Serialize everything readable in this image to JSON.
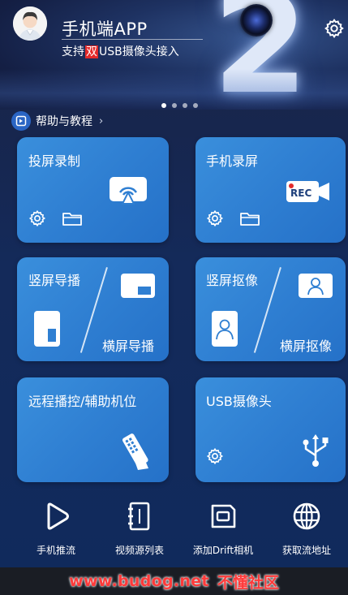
{
  "header": {
    "app_title": "手机端APP",
    "subtitle_before": "支持",
    "subtitle_highlight": "双",
    "subtitle_after": "USB摄像头接入",
    "banner_numeral": "2",
    "carousel_page_count": 4,
    "carousel_active_index": 0
  },
  "help": {
    "label": "帮助与教程",
    "chevron": "›"
  },
  "cards": {
    "screen_cast_record": {
      "label": "投屏录制"
    },
    "phone_record": {
      "label": "手机录屏",
      "rec_badge": "REC"
    },
    "portrait_broadcast": {
      "label": "竖屏导播"
    },
    "landscape_broadcast": {
      "label": "横屏导播"
    },
    "portrait_matting": {
      "label": "竖屏抠像"
    },
    "landscape_matting": {
      "label": "横屏抠像"
    },
    "remote_control": {
      "label": "远程播控/辅助机位"
    },
    "usb_camera": {
      "label": "USB摄像头"
    }
  },
  "bottom_nav": [
    {
      "label": "手机推流",
      "icon": "play-icon"
    },
    {
      "label": "视频源列表",
      "icon": "notebook-icon"
    },
    {
      "label": "添加Drift相机",
      "icon": "sd-card-icon"
    },
    {
      "label": "获取流地址",
      "icon": "globe-icon"
    }
  ],
  "watermark": {
    "url": "www.budog.net",
    "name": "不懂社区"
  },
  "colors": {
    "card": "#2f7fd2",
    "background": "#142a5a",
    "highlight": "#e32a2a",
    "rec": "#e32a2a"
  }
}
